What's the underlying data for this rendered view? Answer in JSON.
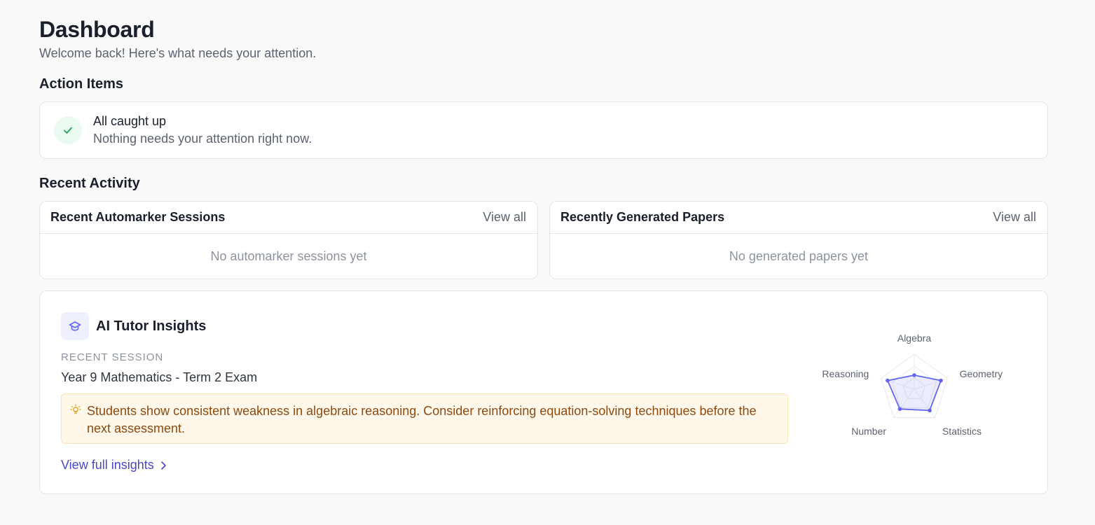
{
  "header": {
    "title": "Dashboard",
    "subtitle": "Welcome back! Here's what needs your attention."
  },
  "action_items": {
    "heading": "Action Items",
    "status_title": "All caught up",
    "status_message": "Nothing needs your attention right now.",
    "icon": "check-icon"
  },
  "recent_activity": {
    "heading": "Recent Activity",
    "automarker": {
      "title": "Recent Automarker Sessions",
      "view_all": "View all",
      "empty": "No automarker sessions yet"
    },
    "papers": {
      "title": "Recently Generated Papers",
      "view_all": "View all",
      "empty": "No generated papers yet"
    }
  },
  "insights": {
    "title": "AI Tutor Insights",
    "icon": "graduation-cap-icon",
    "session_label": "RECENT SESSION",
    "session_name": "Year 9 Mathematics - Term 2 Exam",
    "alert_text": "Students show consistent weakness in algebraic reasoning. Consider reinforcing equation-solving techniques before the next assessment.",
    "alert_icon": "lightbulb-icon",
    "link_text": "View full insights",
    "link_icon": "chevron-right-icon"
  },
  "chart_data": {
    "type": "radar",
    "categories": [
      "Algebra",
      "Geometry",
      "Statistics",
      "Number",
      "Reasoning"
    ],
    "values": [
      0.4,
      0.8,
      0.75,
      0.7,
      0.8
    ],
    "range": [
      0,
      1
    ],
    "grid": true,
    "color": "#6366f1"
  },
  "colors": {
    "accent": "#4a47c4",
    "success": "#22a55a",
    "warning_bg": "#fff8ea",
    "warning_text": "#8a4a10"
  }
}
